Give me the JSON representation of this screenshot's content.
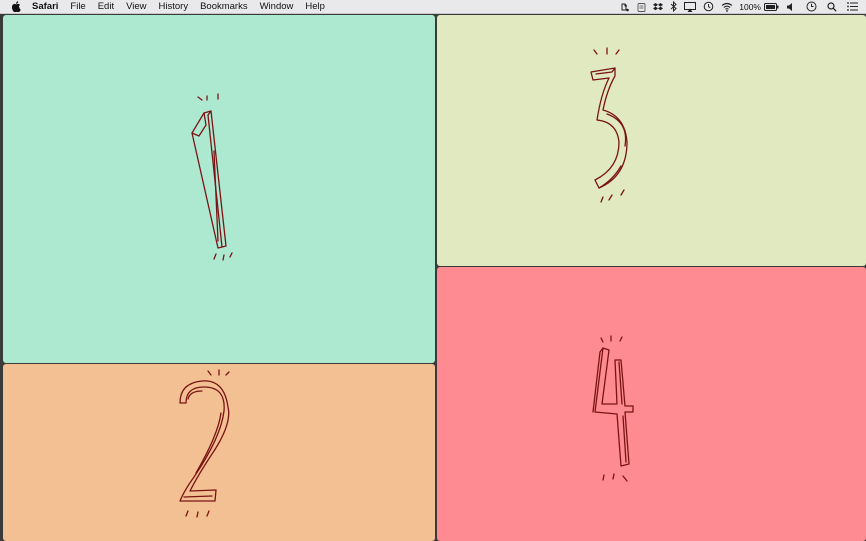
{
  "menubar": {
    "apple_icon": "apple-logo-icon",
    "app_name": "Safari",
    "items": [
      "File",
      "Edit",
      "View",
      "History",
      "Bookmarks",
      "Window",
      "Help"
    ],
    "battery_percent": "100%",
    "status_icons": [
      "evernote-icon",
      "clipboard-icon",
      "dropbox-icon",
      "bluetooth-icon",
      "airplay-icon",
      "time-machine-icon",
      "wifi-icon",
      "battery-icon",
      "volume-icon",
      "clock-icon",
      "spotlight-search-icon",
      "notification-center-icon"
    ]
  },
  "panels": [
    {
      "id": "panel-1",
      "number": "1",
      "color": "#ade9d1"
    },
    {
      "id": "panel-2",
      "number": "2",
      "color": "#f2c092"
    },
    {
      "id": "panel-3",
      "number": "3",
      "color": "#e0e9bf"
    },
    {
      "id": "panel-4",
      "number": "4",
      "color": "#fd8b91"
    }
  ],
  "colors": {
    "ink": "#7a1414",
    "menubar_bg": "#e9e9eb",
    "gutter": "#3a3a3a"
  }
}
